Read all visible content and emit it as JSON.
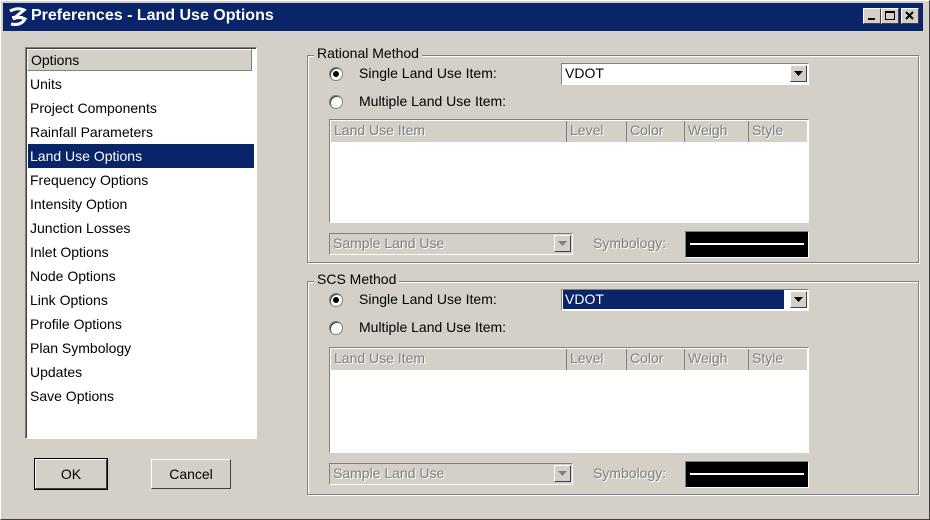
{
  "window": {
    "title": "Preferences - Land Use Options"
  },
  "options_list": {
    "header": "Options",
    "items": [
      "Units",
      "Project Components",
      "Rainfall Parameters",
      "Land Use Options",
      "Frequency Options",
      "Intensity Option",
      "Junction Losses",
      "Inlet Options",
      "Node Options",
      "Link Options",
      "Profile Options",
      "Plan Symbology",
      "Updates",
      "Save Options"
    ],
    "selected": "Land Use Options"
  },
  "buttons": {
    "ok": "OK",
    "cancel": "Cancel"
  },
  "rational": {
    "legend": "Rational Method",
    "single_label": "Single Land Use Item:",
    "multiple_label": "Multiple Land Use Item:",
    "selected_option": "single",
    "single_value": "VDOT",
    "columns": [
      "Land Use Item",
      "Level",
      "Color",
      "Weigh",
      "Style"
    ],
    "sample_value": "Sample Land Use",
    "symbology_label": "Symbology:"
  },
  "scs": {
    "legend": "SCS Method",
    "single_label": "Single Land Use Item:",
    "multiple_label": "Multiple Land Use Item:",
    "selected_option": "single",
    "single_value": "VDOT",
    "columns": [
      "Land Use Item",
      "Level",
      "Color",
      "Weigh",
      "Style"
    ],
    "sample_value": "Sample Land Use",
    "symbology_label": "Symbology:"
  },
  "colors": {
    "titlebar": "#0a246a",
    "face": "#d4d0c8",
    "selection": "#0a246a"
  }
}
